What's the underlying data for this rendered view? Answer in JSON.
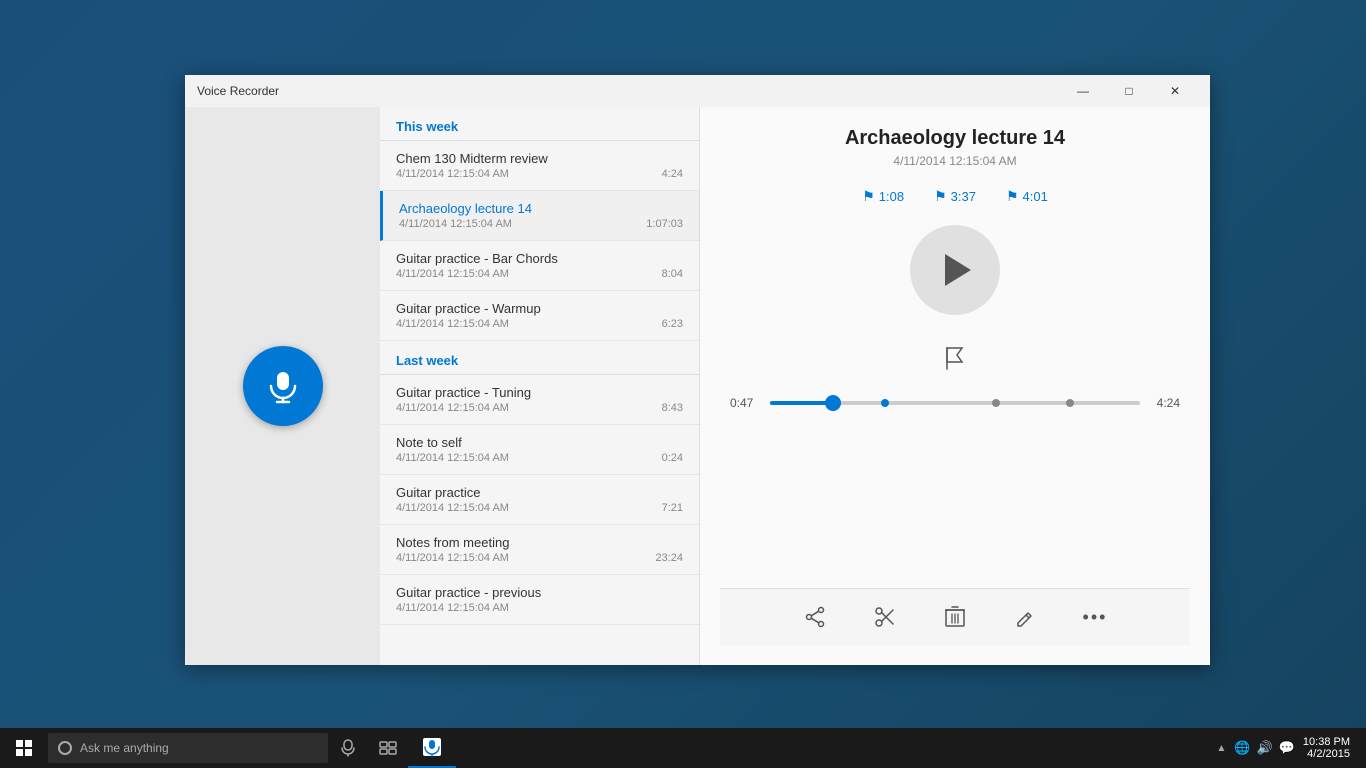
{
  "desktop": {
    "background": "#1a5276"
  },
  "window": {
    "title": "Voice Recorder",
    "controls": {
      "minimize": "—",
      "maximize": "□",
      "close": "✕"
    }
  },
  "list": {
    "this_week_header": "This week",
    "last_week_header": "Last week",
    "items": [
      {
        "id": 1,
        "name": "Chem 130 Midterm review",
        "date": "4/11/2014 12:15:04 AM",
        "duration": "4:24",
        "section": "this_week",
        "selected": false
      },
      {
        "id": 2,
        "name": "Archaeology lecture 14",
        "date": "4/11/2014 12:15:04 AM",
        "duration": "1:07:03",
        "section": "this_week",
        "selected": true
      },
      {
        "id": 3,
        "name": "Guitar practice - Bar Chords",
        "date": "4/11/2014 12:15:04 AM",
        "duration": "8:04",
        "section": "this_week",
        "selected": false
      },
      {
        "id": 4,
        "name": "Guitar practice - Warmup",
        "date": "4/11/2014 12:15:04 AM",
        "duration": "6:23",
        "section": "this_week",
        "selected": false
      },
      {
        "id": 5,
        "name": "Guitar practice - Tuning",
        "date": "4/11/2014 12:15:04 AM",
        "duration": "8:43",
        "section": "last_week",
        "selected": false
      },
      {
        "id": 6,
        "name": "Note to self",
        "date": "4/11/2014 12:15:04 AM",
        "duration": "0:24",
        "section": "last_week",
        "selected": false
      },
      {
        "id": 7,
        "name": "Guitar practice",
        "date": "4/11/2014 12:15:04 AM",
        "duration": "7:21",
        "section": "last_week",
        "selected": false
      },
      {
        "id": 8,
        "name": "Notes from meeting",
        "date": "4/11/2014 12:15:04 AM",
        "duration": "23:24",
        "section": "last_week",
        "selected": false
      },
      {
        "id": 9,
        "name": "Guitar practice - previous",
        "date": "4/11/2014 12:15:04 AM",
        "duration": "",
        "section": "last_week",
        "selected": false
      }
    ]
  },
  "player": {
    "title": "Archaeology lecture 14",
    "date": "4/11/2014 12:15:04 AM",
    "markers": [
      {
        "time": "1:08"
      },
      {
        "time": "3:37"
      },
      {
        "time": "4:01"
      }
    ],
    "current_time": "0:47",
    "total_time": "4:24",
    "progress_percent": 17
  },
  "toolbar": {
    "share_label": "share",
    "trim_label": "trim",
    "delete_label": "delete",
    "rename_label": "rename",
    "more_label": "more"
  },
  "taskbar": {
    "search_placeholder": "Ask me anything",
    "time": "10:38 PM",
    "date": "4/2/2015"
  }
}
